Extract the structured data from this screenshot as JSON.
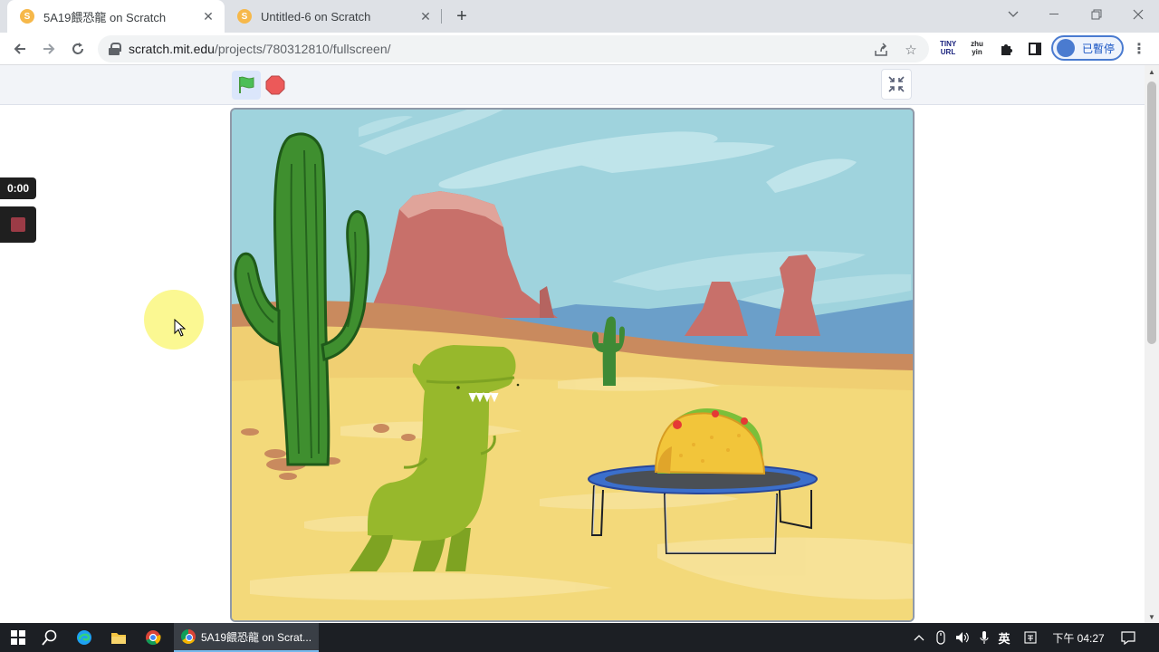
{
  "browser": {
    "tabs": [
      {
        "title": "5A19餵恐龍 on Scratch",
        "active": true
      },
      {
        "title": "Untitled-6 on Scratch",
        "active": false
      }
    ],
    "url_domain": "scratch.mit.edu",
    "url_path": "/projects/780312810/fullscreen/",
    "extensions": [
      {
        "icon": "tinyurl-icon",
        "label": "TINY URL"
      },
      {
        "icon": "zhuyin-icon",
        "label": "zhu yin"
      }
    ],
    "profile_label": "已暫停"
  },
  "page": {
    "icons": {
      "green_flag": "green-flag-icon",
      "stop": "stop-icon",
      "exit_fullscreen": "exit-fullscreen-icon"
    },
    "recorder": {
      "timer": "0:00"
    }
  },
  "stage": {
    "sprites": [
      "cactus",
      "dinosaur",
      "taco",
      "trampoline"
    ],
    "backdrop": "desert"
  },
  "taskbar": {
    "app_label": "5A19餵恐龍 on Scrat...",
    "ime_label": "英",
    "time": "下午 04:27"
  },
  "colors": {
    "sky": "#9fd3dd",
    "sand": "#f3d97a",
    "accent": "#4a7bd0"
  }
}
